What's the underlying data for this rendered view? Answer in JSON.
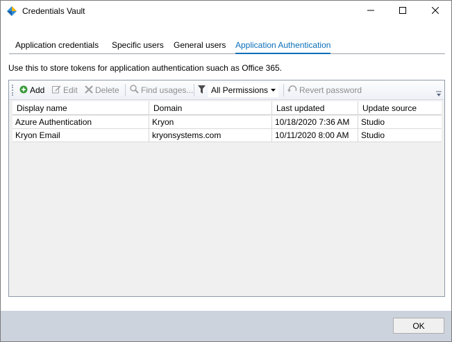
{
  "window": {
    "title": "Credentials Vault",
    "accent_color": "#0b6fb8"
  },
  "tabs": [
    {
      "label": "Application credentials",
      "active": false
    },
    {
      "label": "Specific users",
      "active": false
    },
    {
      "label": "General users",
      "active": false
    },
    {
      "label": "Application Authentication",
      "active": true
    }
  ],
  "description": "Use this to store tokens for application authentication suach as Office 365.",
  "toolbar": {
    "add_label": "Add",
    "edit_label": "Edit",
    "delete_label": "Delete",
    "find_usages_label": "Find usages...",
    "permissions_selected": "All Permissions",
    "revert_password_label": "Revert password"
  },
  "grid": {
    "columns": [
      "Display name",
      "Domain",
      "Last updated",
      "Update source"
    ],
    "rows": [
      [
        "Azure Authentication",
        "Kryon",
        "10/18/2020 7:36 AM",
        "Studio"
      ],
      [
        "Kryon Email",
        "kryonsystems.com",
        "10/11/2020 8:00 AM",
        "Studio"
      ]
    ]
  },
  "footer": {
    "ok_label": "OK"
  }
}
